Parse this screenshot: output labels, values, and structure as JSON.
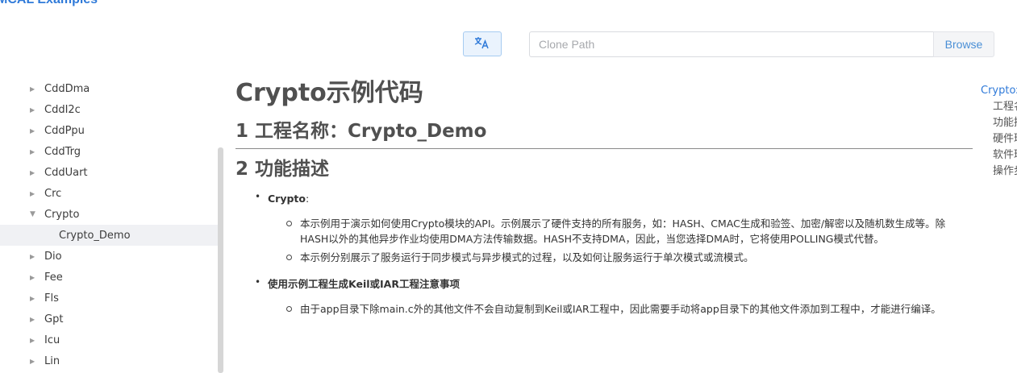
{
  "app": {
    "title": "MCAL Examples"
  },
  "toolbar": {
    "translate_icon": "translate-icon",
    "clone_placeholder": "Clone Path",
    "browse_label": "Browse"
  },
  "sidebar": {
    "items": [
      {
        "label": "CddDma",
        "expanded": false
      },
      {
        "label": "CddI2c",
        "expanded": false
      },
      {
        "label": "CddPpu",
        "expanded": false
      },
      {
        "label": "CddTrg",
        "expanded": false
      },
      {
        "label": "CddUart",
        "expanded": false
      },
      {
        "label": "Crc",
        "expanded": false
      },
      {
        "label": "Crypto",
        "expanded": true
      },
      {
        "label": "Crypto_Demo",
        "child": true,
        "active": true
      },
      {
        "label": "Dio",
        "expanded": false
      },
      {
        "label": "Fee",
        "expanded": false
      },
      {
        "label": "Fls",
        "expanded": false
      },
      {
        "label": "Gpt",
        "expanded": false
      },
      {
        "label": "Icu",
        "expanded": false
      },
      {
        "label": "Lin",
        "expanded": false
      }
    ]
  },
  "content": {
    "title": "Crypto示例代码",
    "section1": "1 工程名称：Crypto_Demo",
    "section2": "2 功能描述",
    "bullets": [
      {
        "title": "Crypto",
        "suffix": ":",
        "subs": [
          "本示例用于演示如何使用Crypto模块的API。示例展示了硬件支持的所有服务，如：HASH、CMAC生成和验签、加密/解密以及随机数生成等。除HASH以外的其他异步作业均使用DMA方法传输数据。HASH不支持DMA，因此，当您选择DMA时，它将使用POLLING模式代替。",
          "本示例分别展示了服务运行于同步模式与异步模式的过程，以及如何让服务运行于单次模式或流模式。"
        ]
      },
      {
        "title": "使用示例工程生成Keil或IAR工程注意事项",
        "suffix": "",
        "subs": [
          "由于app目录下除main.c外的其他文件不会自动复制到Keil或IAR工程中，因此需要手动将app目录下的其他文件添加到工程中，才能进行编译。"
        ]
      }
    ]
  },
  "toc": {
    "items": [
      {
        "label": "Crypto示例代码",
        "main": true
      },
      {
        "label": "工程名称"
      },
      {
        "label": "功能描述"
      },
      {
        "label": "硬件环境"
      },
      {
        "label": "软件环境"
      },
      {
        "label": "操作步骤"
      }
    ]
  },
  "colors": {
    "accent": "#2f7ad9",
    "heading": "#505050",
    "active_bg": "#f0f1f4"
  }
}
